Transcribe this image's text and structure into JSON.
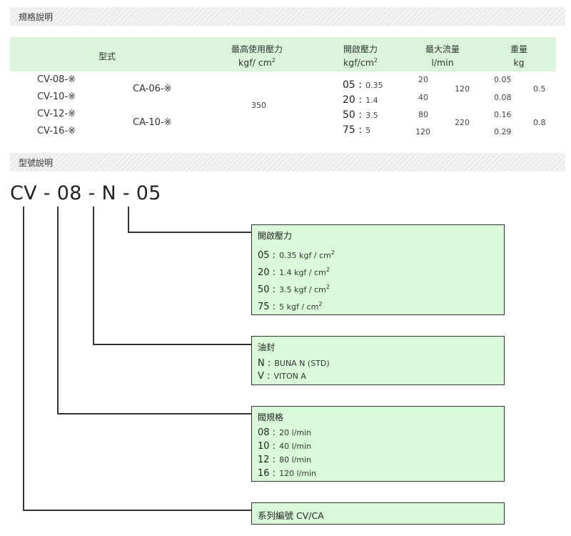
{
  "spec_section": {
    "title": "規格說明"
  },
  "model_section": {
    "title": "型號說明"
  },
  "spec_table": {
    "headers": {
      "model": "型式",
      "max_pressure": "最高使用壓力",
      "max_pressure_unit": "kgf/ cm",
      "crack_pressure": "開啟壓力",
      "crack_pressure_unit": "kgf/cm",
      "max_flow": "最大流量",
      "max_flow_unit": "l/min",
      "weight": "重量",
      "weight_unit": "kg",
      "unit_exp": "2"
    },
    "cv_models": [
      "CV-08-※",
      "CV-10-※",
      "CV-12-※",
      "CV-16-※"
    ],
    "ca_models": [
      "CA-06-※",
      "CA-10-※"
    ],
    "max_pressure_value": "350",
    "crack_pressures": [
      {
        "code": "05 :",
        "value": "0.35"
      },
      {
        "code": "20 :",
        "value": "1.4"
      },
      {
        "code": "50 :",
        "value": "3.5"
      },
      {
        "code": "75 :",
        "value": "5"
      }
    ],
    "flows": [
      "20",
      "40",
      "80",
      "120"
    ],
    "ca_flows": [
      "120",
      "220"
    ],
    "weights": [
      "0.05",
      "0.08",
      "0.16",
      "0.29"
    ],
    "ca_weights": [
      "0.5",
      "0.8"
    ]
  },
  "model_code": {
    "text": "CV - 08 - N - 05"
  },
  "boxes": {
    "crack_pressure": {
      "title": "開啟壓力",
      "rows": [
        {
          "k": "05 :",
          "v": "0.35 kgf / cm"
        },
        {
          "k": "20 :",
          "v": "1.4 kgf / cm"
        },
        {
          "k": "50 :",
          "v": "3.5 kgf / cm"
        },
        {
          "k": "75 :",
          "v": "5 kgf / cm"
        }
      ],
      "exp": "2"
    },
    "seal": {
      "title": "油封",
      "rows": [
        {
          "k": "N :",
          "v": "BUNA N (STD)"
        },
        {
          "k": "V :",
          "v": "VITON A"
        }
      ]
    },
    "valve_size": {
      "title": "閥規格",
      "rows": [
        {
          "k": "08 :",
          "v": "20 l/min"
        },
        {
          "k": "10 :",
          "v": "40 l/min"
        },
        {
          "k": "12 :",
          "v": "80 l/min"
        },
        {
          "k": "16 :",
          "v": "120 l/min"
        }
      ]
    },
    "series": {
      "label": "系列編號 CV/CA"
    }
  }
}
